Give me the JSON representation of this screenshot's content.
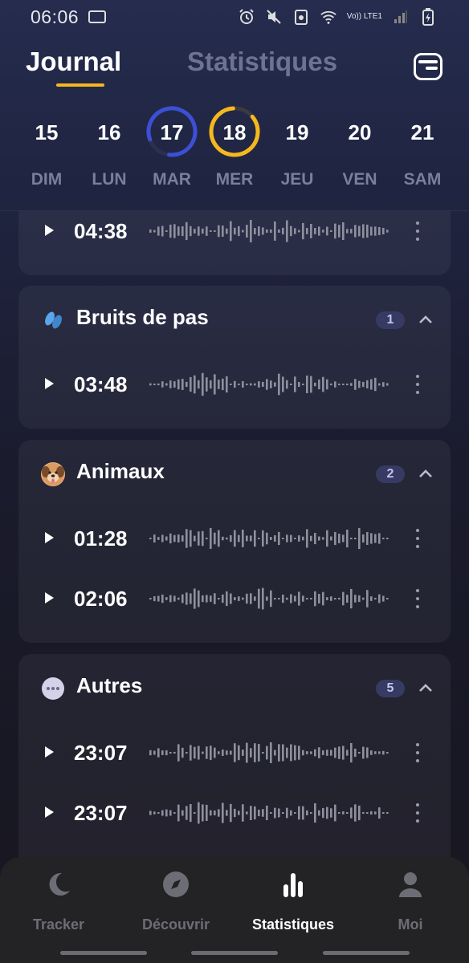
{
  "status_bar": {
    "time": "06:06",
    "network": "Vo)) LTE1"
  },
  "header": {
    "tabs": [
      {
        "label": "Journal",
        "active": true
      },
      {
        "label": "Statistiques",
        "active": false
      }
    ],
    "calendar_icon": "calendar-list-icon"
  },
  "week": {
    "days": [
      {
        "num": "15",
        "name": "DIM"
      },
      {
        "num": "16",
        "name": "LUN"
      },
      {
        "num": "17",
        "name": "MAR",
        "ring_color": "#3c4fd6"
      },
      {
        "num": "18",
        "name": "MER",
        "ring_color": "#f5b81d"
      },
      {
        "num": "19",
        "name": "JEU"
      },
      {
        "num": "20",
        "name": "VEN"
      },
      {
        "num": "21",
        "name": "SAM"
      }
    ]
  },
  "groups": [
    {
      "title": "",
      "count": "",
      "recordings": [
        {
          "time": "04:38"
        }
      ]
    },
    {
      "title": "Bruits de pas",
      "icon": "footprints-icon",
      "count": "1",
      "recordings": [
        {
          "time": "03:48"
        }
      ]
    },
    {
      "title": "Animaux",
      "icon": "dog-icon",
      "count": "2",
      "recordings": [
        {
          "time": "01:28"
        },
        {
          "time": "02:06"
        }
      ]
    },
    {
      "title": "Autres",
      "icon": "ellipsis-icon",
      "count": "5",
      "recordings": [
        {
          "time": "23:07"
        },
        {
          "time": "23:07"
        }
      ]
    }
  ],
  "bottom_nav": {
    "items": [
      {
        "label": "Tracker",
        "icon": "moon-icon",
        "active": false
      },
      {
        "label": "Découvrir",
        "icon": "compass-icon",
        "active": false
      },
      {
        "label": "Statistiques",
        "icon": "bar-chart-icon",
        "active": true
      },
      {
        "label": "Moi",
        "icon": "person-icon",
        "active": false
      }
    ]
  },
  "colors": {
    "accent_yellow": "#f7b51f",
    "accent_blue": "#3c4fd6",
    "badge_bg": "#373b63",
    "inactive_text": "#6e7391"
  }
}
